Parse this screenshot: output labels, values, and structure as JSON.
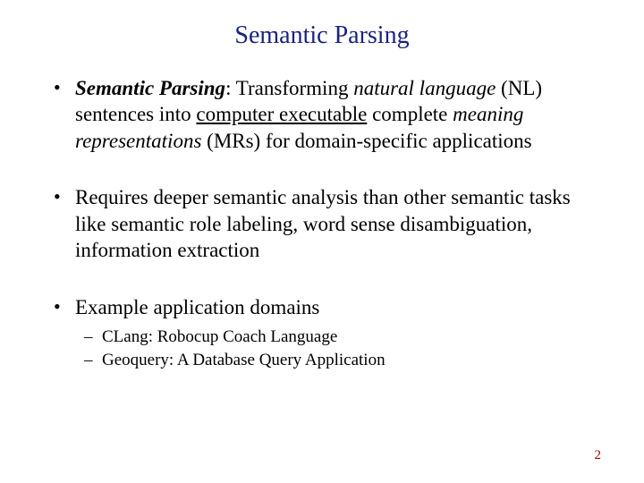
{
  "title": "Semantic Parsing",
  "bullets": {
    "b1": {
      "seg1": "Semantic Parsing",
      "seg2": ": Transforming ",
      "seg3": "natural language",
      "seg4": " (NL) sentences into ",
      "seg5": "computer executable",
      "seg6": " complete ",
      "seg7": "meaning representations",
      "seg8": " (MRs) for domain-specific applications"
    },
    "b2": "Requires deeper semantic analysis than other semantic tasks like semantic role labeling, word sense disambiguation, information extraction",
    "b3": {
      "main": "Example application domains",
      "sub1": "CLang: Robocup Coach Language",
      "sub2": "Geoquery: A Database Query Application"
    }
  },
  "page_number": "2"
}
